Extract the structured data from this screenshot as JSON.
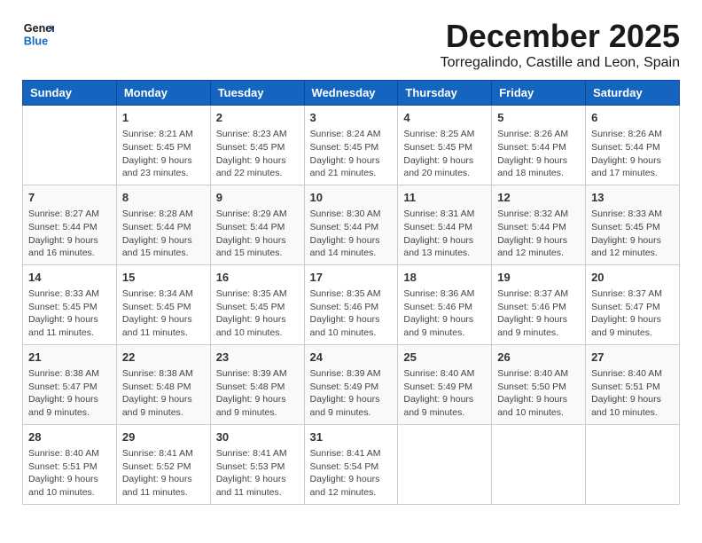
{
  "logo": {
    "line1": "General",
    "line2": "Blue"
  },
  "title": "December 2025",
  "location": "Torregalindo, Castille and Leon, Spain",
  "days_of_week": [
    "Sunday",
    "Monday",
    "Tuesday",
    "Wednesday",
    "Thursday",
    "Friday",
    "Saturday"
  ],
  "weeks": [
    [
      {
        "day": "",
        "info": ""
      },
      {
        "day": "1",
        "info": "Sunrise: 8:21 AM\nSunset: 5:45 PM\nDaylight: 9 hours\nand 23 minutes."
      },
      {
        "day": "2",
        "info": "Sunrise: 8:23 AM\nSunset: 5:45 PM\nDaylight: 9 hours\nand 22 minutes."
      },
      {
        "day": "3",
        "info": "Sunrise: 8:24 AM\nSunset: 5:45 PM\nDaylight: 9 hours\nand 21 minutes."
      },
      {
        "day": "4",
        "info": "Sunrise: 8:25 AM\nSunset: 5:45 PM\nDaylight: 9 hours\nand 20 minutes."
      },
      {
        "day": "5",
        "info": "Sunrise: 8:26 AM\nSunset: 5:44 PM\nDaylight: 9 hours\nand 18 minutes."
      },
      {
        "day": "6",
        "info": "Sunrise: 8:26 AM\nSunset: 5:44 PM\nDaylight: 9 hours\nand 17 minutes."
      }
    ],
    [
      {
        "day": "7",
        "info": "Sunrise: 8:27 AM\nSunset: 5:44 PM\nDaylight: 9 hours\nand 16 minutes."
      },
      {
        "day": "8",
        "info": "Sunrise: 8:28 AM\nSunset: 5:44 PM\nDaylight: 9 hours\nand 15 minutes."
      },
      {
        "day": "9",
        "info": "Sunrise: 8:29 AM\nSunset: 5:44 PM\nDaylight: 9 hours\nand 15 minutes."
      },
      {
        "day": "10",
        "info": "Sunrise: 8:30 AM\nSunset: 5:44 PM\nDaylight: 9 hours\nand 14 minutes."
      },
      {
        "day": "11",
        "info": "Sunrise: 8:31 AM\nSunset: 5:44 PM\nDaylight: 9 hours\nand 13 minutes."
      },
      {
        "day": "12",
        "info": "Sunrise: 8:32 AM\nSunset: 5:44 PM\nDaylight: 9 hours\nand 12 minutes."
      },
      {
        "day": "13",
        "info": "Sunrise: 8:33 AM\nSunset: 5:45 PM\nDaylight: 9 hours\nand 12 minutes."
      }
    ],
    [
      {
        "day": "14",
        "info": "Sunrise: 8:33 AM\nSunset: 5:45 PM\nDaylight: 9 hours\nand 11 minutes."
      },
      {
        "day": "15",
        "info": "Sunrise: 8:34 AM\nSunset: 5:45 PM\nDaylight: 9 hours\nand 11 minutes."
      },
      {
        "day": "16",
        "info": "Sunrise: 8:35 AM\nSunset: 5:45 PM\nDaylight: 9 hours\nand 10 minutes."
      },
      {
        "day": "17",
        "info": "Sunrise: 8:35 AM\nSunset: 5:46 PM\nDaylight: 9 hours\nand 10 minutes."
      },
      {
        "day": "18",
        "info": "Sunrise: 8:36 AM\nSunset: 5:46 PM\nDaylight: 9 hours\nand 9 minutes."
      },
      {
        "day": "19",
        "info": "Sunrise: 8:37 AM\nSunset: 5:46 PM\nDaylight: 9 hours\nand 9 minutes."
      },
      {
        "day": "20",
        "info": "Sunrise: 8:37 AM\nSunset: 5:47 PM\nDaylight: 9 hours\nand 9 minutes."
      }
    ],
    [
      {
        "day": "21",
        "info": "Sunrise: 8:38 AM\nSunset: 5:47 PM\nDaylight: 9 hours\nand 9 minutes."
      },
      {
        "day": "22",
        "info": "Sunrise: 8:38 AM\nSunset: 5:48 PM\nDaylight: 9 hours\nand 9 minutes."
      },
      {
        "day": "23",
        "info": "Sunrise: 8:39 AM\nSunset: 5:48 PM\nDaylight: 9 hours\nand 9 minutes."
      },
      {
        "day": "24",
        "info": "Sunrise: 8:39 AM\nSunset: 5:49 PM\nDaylight: 9 hours\nand 9 minutes."
      },
      {
        "day": "25",
        "info": "Sunrise: 8:40 AM\nSunset: 5:49 PM\nDaylight: 9 hours\nand 9 minutes."
      },
      {
        "day": "26",
        "info": "Sunrise: 8:40 AM\nSunset: 5:50 PM\nDaylight: 9 hours\nand 10 minutes."
      },
      {
        "day": "27",
        "info": "Sunrise: 8:40 AM\nSunset: 5:51 PM\nDaylight: 9 hours\nand 10 minutes."
      }
    ],
    [
      {
        "day": "28",
        "info": "Sunrise: 8:40 AM\nSunset: 5:51 PM\nDaylight: 9 hours\nand 10 minutes."
      },
      {
        "day": "29",
        "info": "Sunrise: 8:41 AM\nSunset: 5:52 PM\nDaylight: 9 hours\nand 11 minutes."
      },
      {
        "day": "30",
        "info": "Sunrise: 8:41 AM\nSunset: 5:53 PM\nDaylight: 9 hours\nand 11 minutes."
      },
      {
        "day": "31",
        "info": "Sunrise: 8:41 AM\nSunset: 5:54 PM\nDaylight: 9 hours\nand 12 minutes."
      },
      {
        "day": "",
        "info": ""
      },
      {
        "day": "",
        "info": ""
      },
      {
        "day": "",
        "info": ""
      }
    ]
  ]
}
